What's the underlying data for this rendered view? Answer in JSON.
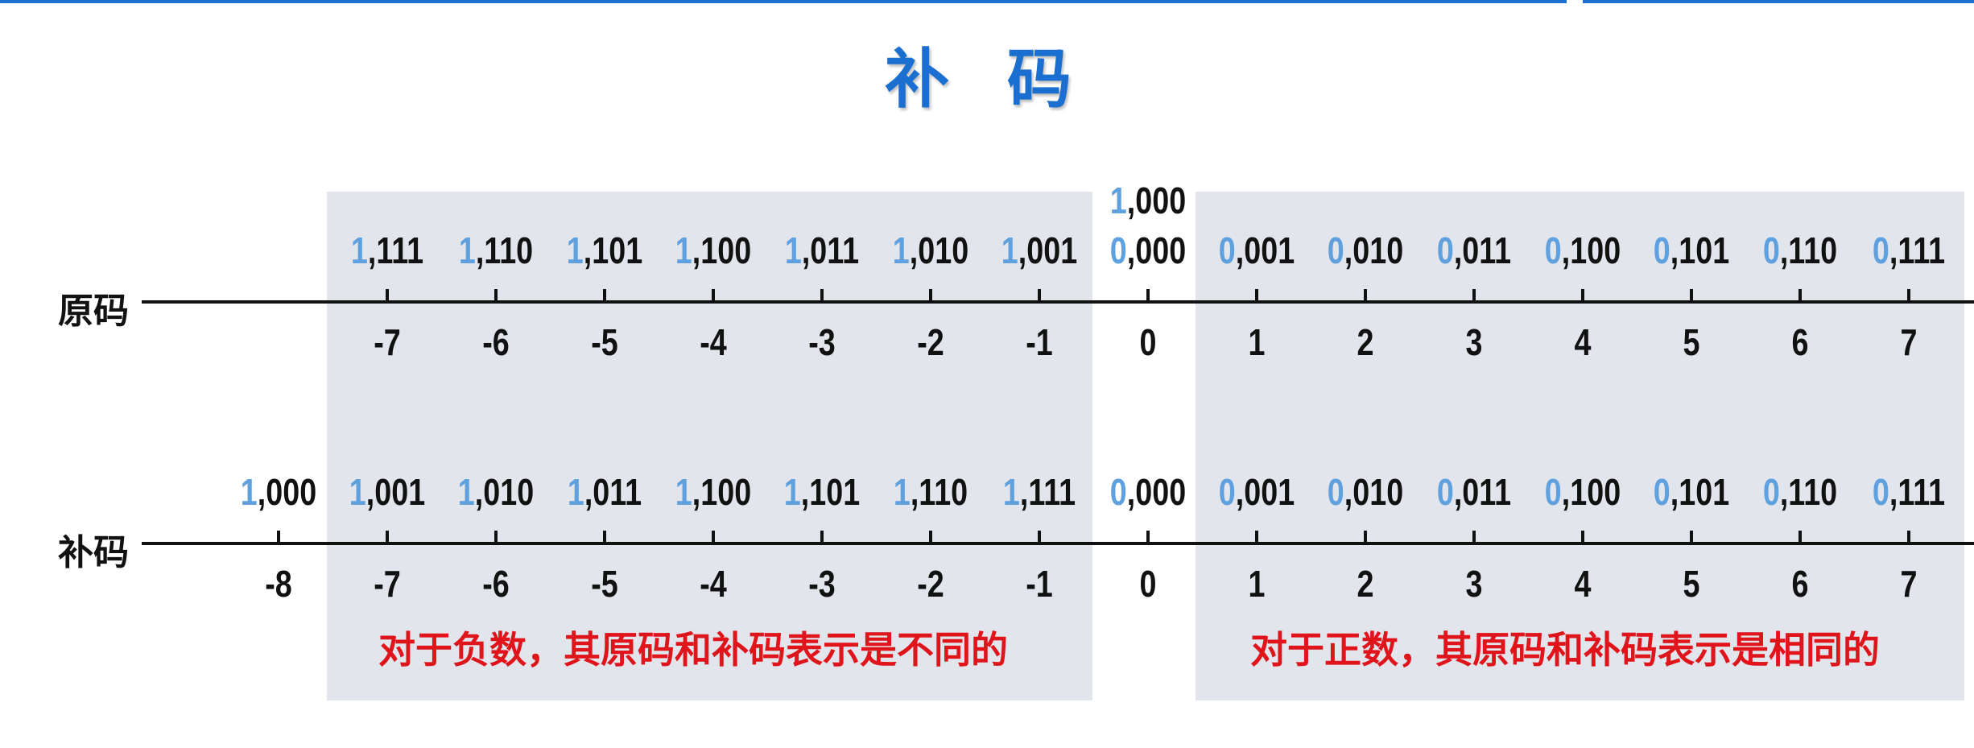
{
  "title": "补 码",
  "rows": {
    "original": {
      "label": "原码",
      "zero_extra": {
        "sign": "1",
        "rest": ",000"
      },
      "codes": [
        {
          "sign": "1",
          "rest": ",111"
        },
        {
          "sign": "1",
          "rest": ",110"
        },
        {
          "sign": "1",
          "rest": ",101"
        },
        {
          "sign": "1",
          "rest": ",100"
        },
        {
          "sign": "1",
          "rest": ",011"
        },
        {
          "sign": "1",
          "rest": ",010"
        },
        {
          "sign": "1",
          "rest": ",001"
        },
        {
          "sign": "0",
          "rest": ",000"
        },
        {
          "sign": "0",
          "rest": ",001"
        },
        {
          "sign": "0",
          "rest": ",010"
        },
        {
          "sign": "0",
          "rest": ",011"
        },
        {
          "sign": "0",
          "rest": ",100"
        },
        {
          "sign": "0",
          "rest": ",101"
        },
        {
          "sign": "0",
          "rest": ",110"
        },
        {
          "sign": "0",
          "rest": ",111"
        }
      ],
      "numbers": [
        "-7",
        "-6",
        "-5",
        "-4",
        "-3",
        "-2",
        "-1",
        "0",
        "1",
        "2",
        "3",
        "4",
        "5",
        "6",
        "7"
      ]
    },
    "complement": {
      "label": "补码",
      "codes": [
        {
          "sign": "1",
          "rest": ",000"
        },
        {
          "sign": "1",
          "rest": ",001"
        },
        {
          "sign": "1",
          "rest": ",010"
        },
        {
          "sign": "1",
          "rest": ",011"
        },
        {
          "sign": "1",
          "rest": ",100"
        },
        {
          "sign": "1",
          "rest": ",101"
        },
        {
          "sign": "1",
          "rest": ",110"
        },
        {
          "sign": "1",
          "rest": ",111"
        },
        {
          "sign": "0",
          "rest": ",000"
        },
        {
          "sign": "0",
          "rest": ",001"
        },
        {
          "sign": "0",
          "rest": ",010"
        },
        {
          "sign": "0",
          "rest": ",011"
        },
        {
          "sign": "0",
          "rest": ",100"
        },
        {
          "sign": "0",
          "rest": ",101"
        },
        {
          "sign": "0",
          "rest": ",110"
        },
        {
          "sign": "0",
          "rest": ",111"
        }
      ],
      "numbers": [
        "-8",
        "-7",
        "-6",
        "-5",
        "-4",
        "-3",
        "-2",
        "-1",
        "0",
        "1",
        "2",
        "3",
        "4",
        "5",
        "6",
        "7"
      ]
    }
  },
  "notes": {
    "negative": "对于负数，其原码和补码表示是不同的",
    "positive": "对于正数，其原码和补码表示是相同的"
  },
  "colors": {
    "accent": "#1a6fd0",
    "sign_bit": "#5fa0df",
    "note": "#e0141b",
    "panel": "#e3e5ec"
  }
}
